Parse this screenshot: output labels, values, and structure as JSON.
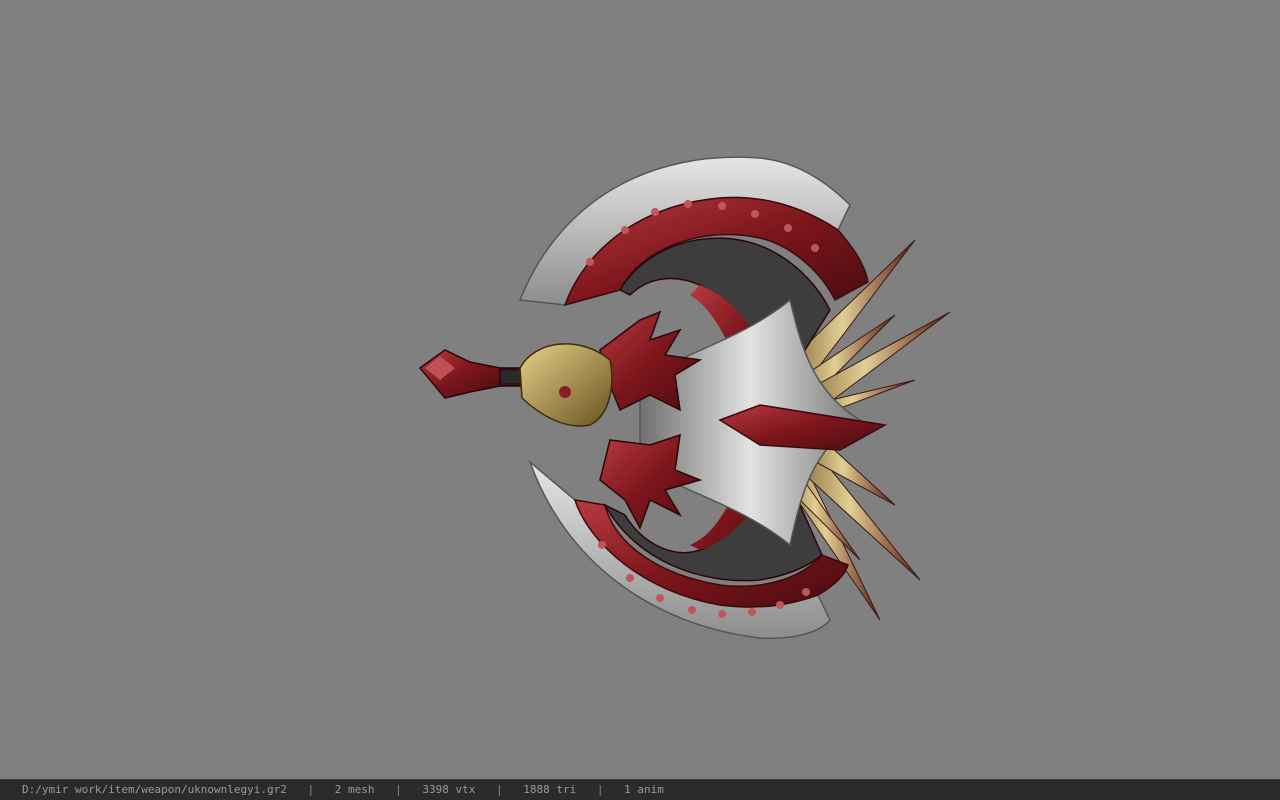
{
  "viewer": {
    "background_color": "#808080",
    "model_icon": "double-bladed-axe-model"
  },
  "status": {
    "file_path": "D:/ymir work/item/weapon/uknownlegyi.gr2",
    "separator": "|",
    "mesh": "2 mesh",
    "vtx": "3398 vtx",
    "tri": "1888 tri",
    "anim": "1 anim"
  },
  "colors": {
    "blade_red": "#8b1e24",
    "blade_edge": "#c9c9c9",
    "feather_gold": "#c8b27a",
    "status_bg": "#2b2b2b",
    "status_text": "#9a9a9a"
  }
}
